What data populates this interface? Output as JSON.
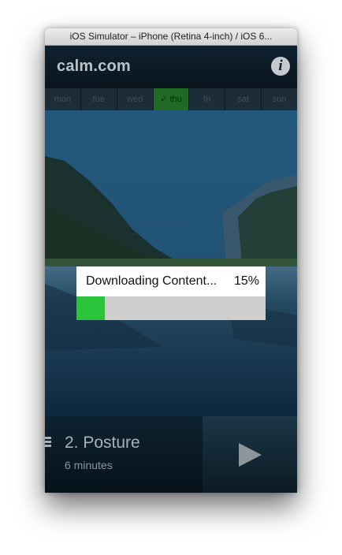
{
  "window": {
    "title": "iOS Simulator – iPhone (Retina 4-inch) / iOS 6..."
  },
  "navbar": {
    "logo": "calm.com",
    "info_icon": "info-icon",
    "info_glyph": "i"
  },
  "days": [
    {
      "label": "mon",
      "active": false
    },
    {
      "label": "tue",
      "active": false
    },
    {
      "label": "wed",
      "active": false
    },
    {
      "label": "✓ thu",
      "active": true
    },
    {
      "label": "fri",
      "active": false
    },
    {
      "label": "sat",
      "active": false
    },
    {
      "label": "sun",
      "active": false
    }
  ],
  "download": {
    "title": "Downloading Content...",
    "percent_text": "15%",
    "progress": 0.15
  },
  "player": {
    "title": "2. Posture",
    "subtitle": "6 minutes",
    "menu_icon": "menu-icon",
    "play_icon": "play-icon"
  },
  "colors": {
    "progress_fill": "#2bc43a",
    "active_day": "#1f6a24",
    "navbar": "#0f2231"
  }
}
